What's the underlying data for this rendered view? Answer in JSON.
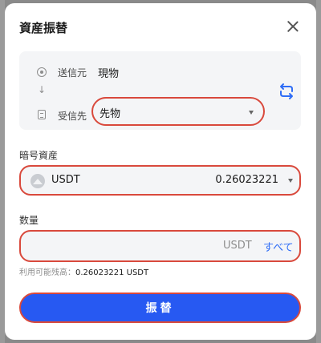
{
  "modal": {
    "title": "資産振替"
  },
  "transfer": {
    "from_label": "送信元",
    "from_value": "現物",
    "to_label": "受信先",
    "to_value": "先物"
  },
  "asset": {
    "label": "暗号資産",
    "name": "USDT",
    "balance": "0.26023221"
  },
  "quantity": {
    "label": "数量",
    "value": "",
    "placeholder": "",
    "unit": "USDT",
    "all_label": "すべて"
  },
  "available": {
    "label": "利用可能残高：",
    "value": "0.26023221 USDT"
  },
  "submit_label": "振替",
  "colors": {
    "accent": "#2759f2",
    "highlight": "#d9493c",
    "link": "#2f6df6"
  },
  "icons": {
    "close": "close-icon",
    "from": "circle-dot-icon",
    "down": "arrow-down-icon",
    "to": "document-icon",
    "swap": "swap-arrows-icon",
    "caret": "caret-down-icon"
  }
}
